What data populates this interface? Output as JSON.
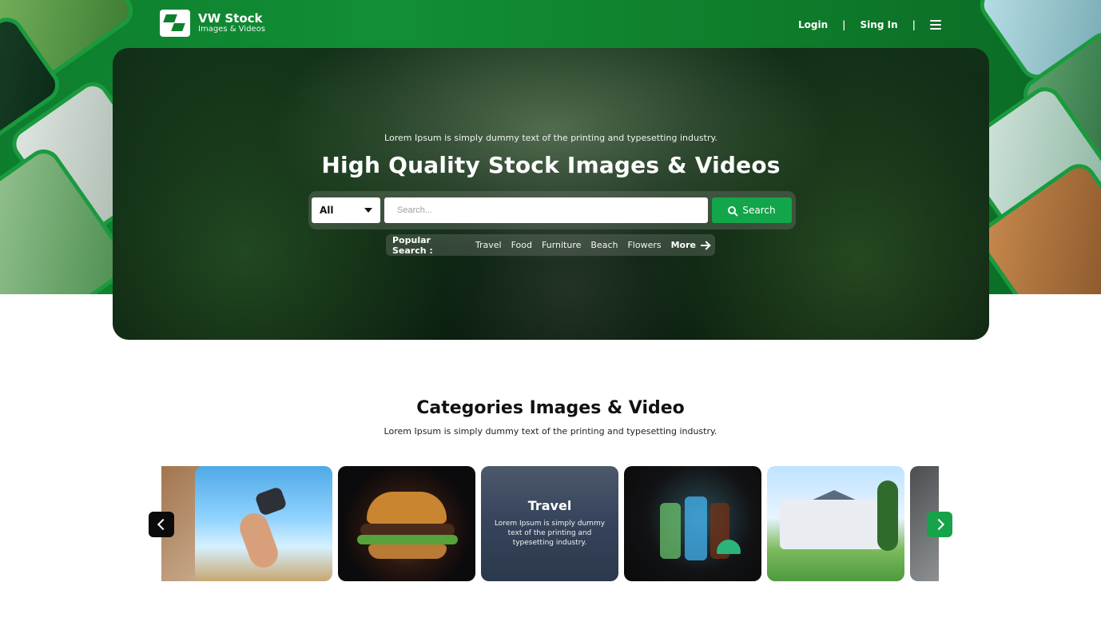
{
  "header": {
    "brand_title": "VW Stock",
    "brand_subtitle": "Images & Videos",
    "nav": {
      "login": "Login",
      "separator1": "|",
      "signin": "Sing In",
      "separator2": "|",
      "menu_icon": "hamburger-menu-icon"
    }
  },
  "hero": {
    "subtitle": "Lorem Ipsum is simply dummy text of the printing and typesetting industry.",
    "title": "High  Quality Stock Images & Videos",
    "search": {
      "category_selected": "All",
      "placeholder": "Search...",
      "button_label": "Search",
      "button_icon": "search-icon"
    },
    "popular": {
      "label": "Popular Search :",
      "tags": [
        "Travel",
        "Food",
        "Furniture",
        "Beach",
        "Flowers"
      ],
      "more_label": "More",
      "more_icon": "arrow-right-icon"
    }
  },
  "categories": {
    "title": "Categories Images & Video",
    "subtitle": "Lorem Ipsum is simply dummy text of the printing and typesetting industry.",
    "carousel": {
      "prev_icon": "chevron-left-icon",
      "next_icon": "chevron-right-icon",
      "active_card": {
        "title": "Travel",
        "text": "Lorem Ipsum is simply dummy text of the printing and typesetting industry."
      }
    }
  },
  "colors": {
    "brand_green": "#0f7f2c",
    "accent_green": "#12a54a"
  }
}
